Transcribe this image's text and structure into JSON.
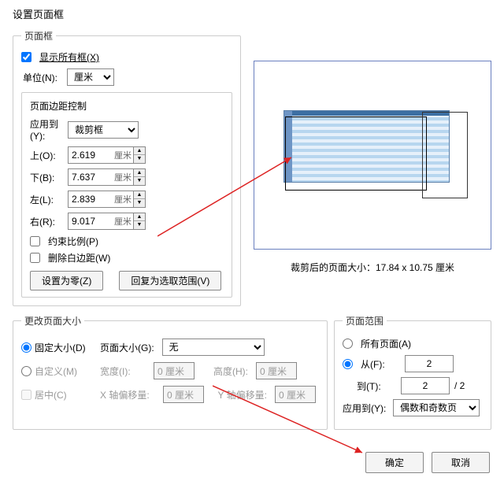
{
  "title": "设置页面框",
  "frame": {
    "legend": "页面框",
    "show_all": "显示所有框(X)",
    "unit_label": "单位(N):",
    "unit_value": "厘米",
    "margin_group_title": "页面边距控制",
    "apply_to_label": "应用到(Y):",
    "apply_to_value": "裁剪框",
    "top_label": "上(O):",
    "top_value": "2.619",
    "bottom_label": "下(B):",
    "bottom_value": "7.637",
    "left_label": "左(L):",
    "left_value": "2.839",
    "right_label": "右(R):",
    "right_value": "9.017",
    "unit_suffix": "厘米",
    "constrain_label": "约束比例(P)",
    "remove_white_label": "删除白边距(W)",
    "reset_btn": "设置为零(Z)",
    "revert_btn": "回复为选取范围(V)"
  },
  "preview": {
    "caption": "裁剪后的页面大小：17.84 x 10.75 厘米"
  },
  "change_size": {
    "legend": "更改页面大小",
    "fixed_label": "固定大小(D)",
    "page_size_label": "页面大小(G):",
    "page_size_value": "无",
    "custom_label": "自定义(M)",
    "width_label": "宽度(I):",
    "width_value": "0 厘米",
    "height_label": "高度(H):",
    "height_value": "0 厘米",
    "center_label": "居中(C)",
    "xoffset_label": "X 轴偏移量:",
    "xoffset_value": "0 厘米",
    "yoffset_label": "Y 轴偏移量:",
    "yoffset_value": "0 厘米"
  },
  "page_range": {
    "legend": "页面范围",
    "all_label": "所有页面(A)",
    "from_label": "从(F):",
    "from_value": "2",
    "to_label": "到(T):",
    "to_value": "2",
    "total": "/ 2",
    "apply_label": "应用到(Y):",
    "apply_value": "偶数和奇数页"
  },
  "footer": {
    "ok": "确定",
    "cancel": "取消"
  }
}
